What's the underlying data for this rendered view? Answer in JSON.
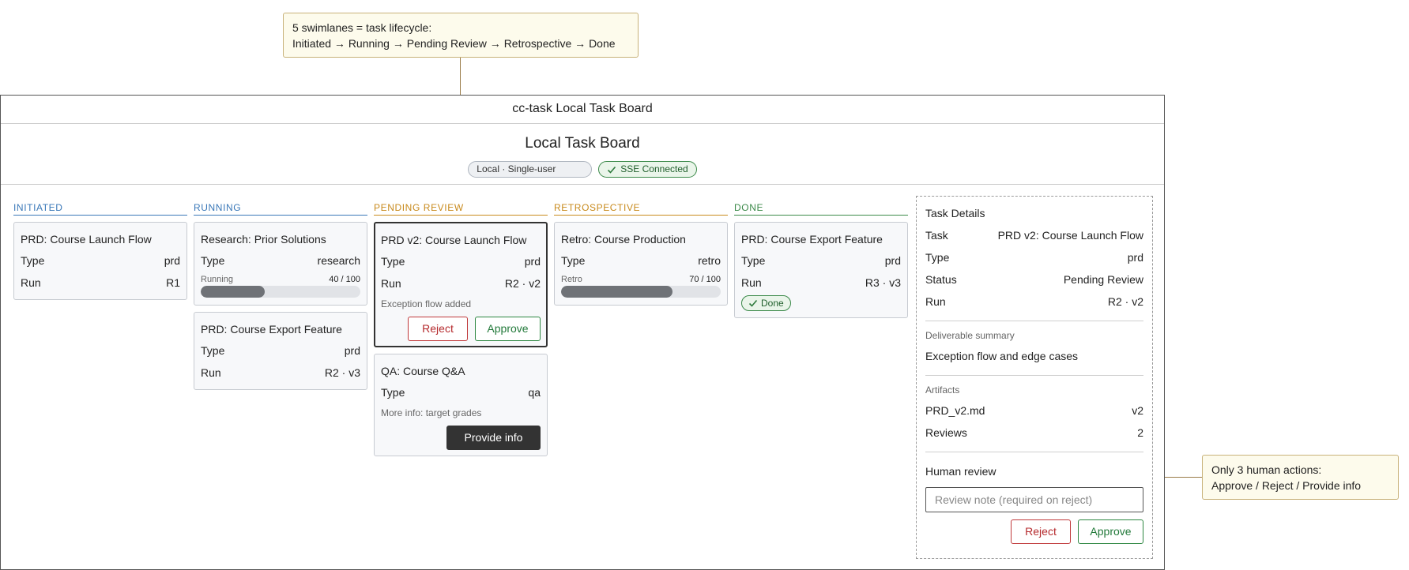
{
  "notes": {
    "swimlanes_line1": "5 swimlanes = task lifecycle:",
    "swimlanes_line2": "Initiated → Running → Pending Review → Retrospective → Done",
    "actions_line1": "Only 3 human actions:",
    "actions_line2": "Approve / Reject / Provide info"
  },
  "window": {
    "title": "cc-task Local Task Board"
  },
  "header": {
    "title": "Local Task Board",
    "mode_pill": "Local · Single-user",
    "sse_status": "SSE Connected"
  },
  "colors": {
    "initiated": "#3a78b8",
    "running": "#3a78b8",
    "pending_review": "#c88a1c",
    "retrospective": "#c88a1c",
    "done": "#3c8a4a",
    "reject": "#c0393b",
    "approve": "#2d8741"
  },
  "columns": {
    "initiated": {
      "label": "INITIATED",
      "cards": [
        {
          "title": "PRD: Course Launch Flow",
          "type_label": "Type",
          "type": "prd",
          "run_label": "Run",
          "run": "R1"
        }
      ]
    },
    "running": {
      "label": "RUNNING",
      "cards": [
        {
          "title": "Research: Prior Solutions",
          "type_label": "Type",
          "type": "research",
          "progress_label": "Running",
          "progress_text": "40 / 100",
          "progress": 40
        },
        {
          "title": "PRD: Course Export Feature",
          "type_label": "Type",
          "type": "prd",
          "run_label": "Run",
          "run": "R2 · v3"
        }
      ]
    },
    "pending_review": {
      "label": "PENDING REVIEW",
      "cards": [
        {
          "title": "PRD v2: Course Launch Flow",
          "type_label": "Type",
          "type": "prd",
          "run_label": "Run",
          "run": "R2 · v2",
          "note": "Exception flow added",
          "reject": "Reject",
          "approve": "Approve"
        },
        {
          "title": "QA: Course Q&A",
          "type_label": "Type",
          "type": "qa",
          "note": "More info: target grades",
          "provide_info": "Provide info"
        }
      ]
    },
    "retrospective": {
      "label": "RETROSPECTIVE",
      "cards": [
        {
          "title": "Retro: Course Production",
          "type_label": "Type",
          "type": "retro",
          "progress_label": "Retro",
          "progress_text": "70 / 100",
          "progress": 70
        }
      ]
    },
    "done": {
      "label": "DONE",
      "cards": [
        {
          "title": "PRD: Course Export Feature",
          "type_label": "Type",
          "type": "prd",
          "run_label": "Run",
          "run": "R3 · v3",
          "badge": "Done"
        }
      ]
    }
  },
  "details": {
    "title": "Task Details",
    "task_label": "Task",
    "task": "PRD v2: Course Launch Flow",
    "type_label": "Type",
    "type": "prd",
    "status_label": "Status",
    "status": "Pending Review",
    "run_label": "Run",
    "run": "R2 · v2",
    "summary_label": "Deliverable summary",
    "summary": "Exception flow and edge cases",
    "artifacts_label": "Artifacts",
    "artifact_name": "PRD_v2.md",
    "artifact_version": "v2",
    "reviews_label": "Reviews",
    "reviews": "2",
    "human_review_label": "Human review",
    "review_placeholder": "Review note (required on reject)",
    "reject": "Reject",
    "approve": "Approve"
  }
}
